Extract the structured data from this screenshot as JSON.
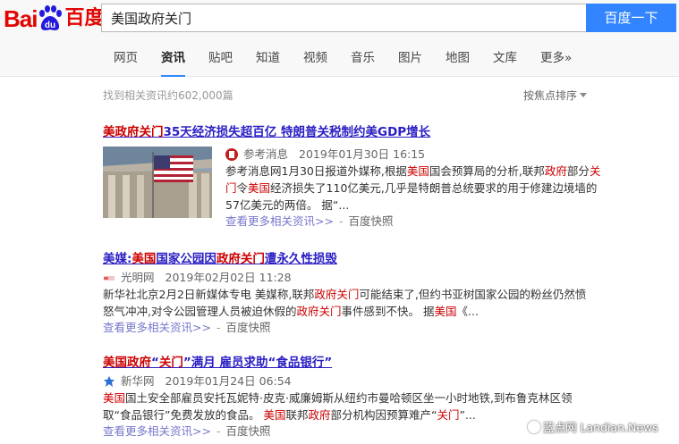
{
  "header": {
    "logo_text": "Bai",
    "logo_du": "du",
    "logo_cn": "百度",
    "search_value": "美国政府关门",
    "search_button": "百度一下"
  },
  "tabs": [
    {
      "label": "网页"
    },
    {
      "label": "资讯"
    },
    {
      "label": "贴吧"
    },
    {
      "label": "知道"
    },
    {
      "label": "视频"
    },
    {
      "label": "音乐"
    },
    {
      "label": "图片"
    },
    {
      "label": "地图"
    },
    {
      "label": "文库"
    },
    {
      "label": "更多»"
    }
  ],
  "summary": {
    "count": "找到相关资讯约602,000篇",
    "sort": "按焦点排序"
  },
  "results": [
    {
      "title": [
        "美政府关门",
        "35天经济损失超百亿 特朗普关税制约美GDP增长"
      ],
      "source": "参考消息",
      "time": "2019年01月30日 16:15",
      "snippet": [
        "参考消息网1月30日报道外媒称,根据",
        "美国",
        "国会预算局的分析,联邦",
        "政府",
        "部分",
        "关门",
        "令",
        "美国",
        "经济损失了110亿美元,几乎是特朗普总统要求的用于修建边境墙的57亿美元的两倍。 据“..."
      ],
      "more": "查看更多相关资讯>>",
      "cache": "百度快照"
    },
    {
      "title": [
        "美媒:",
        "美国",
        "国家公园因",
        "政府关门",
        "遭永久性损毁"
      ],
      "source": "光明网",
      "time": "2019年02月02日 11:28",
      "snippet": [
        "新华社北京2月2日新媒体专电 美媒称,联邦",
        "政府关门",
        "可能结束了,但约书亚树国家公园的粉丝仍然愤怒气冲冲,对令公园管理人员被迫休假的",
        "政府关门",
        "事件感到不快。 据",
        "美国",
        "《..."
      ],
      "more": "查看更多相关资讯>>",
      "cache": "百度快照"
    },
    {
      "title": [
        "美国政府",
        "“",
        "关门",
        "”满月 雇员求助“食品银行”"
      ],
      "source": "新华网",
      "time": "2019年01月24日 06:54",
      "snippet": [
        "美国",
        "国土安全部雇员安托瓦妮特·皮克·威廉姆斯从纽约市曼哈顿区坐一小时地铁,到布鲁克林区领取“食品银行”免费发放的食品。 ",
        "美国",
        "联邦",
        "政府",
        "部分机构因预算难产“",
        "关门",
        "”..."
      ],
      "more": "查看更多相关资讯>>",
      "cache": "百度快照"
    }
  ],
  "watermark": "蓝点网 Landian.News",
  "colors": {
    "logo_red": "#e10602",
    "logo_blue": "#2319dc",
    "search_button": "#3385ff",
    "title_link": "#2a1ec4",
    "highlight": "#cc0000",
    "more_link": "#7777cc"
  }
}
